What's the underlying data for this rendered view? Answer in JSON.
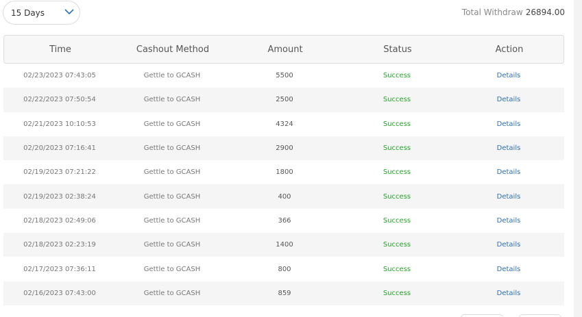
{
  "filter": {
    "selected": "15 Days",
    "icon": "chevron-down-icon",
    "accent": "#2a6ebb"
  },
  "summary": {
    "label": "Total Withdraw",
    "value": "26894.00"
  },
  "table": {
    "headers": {
      "time": "Time",
      "method": "Cashout Method",
      "amount": "Amount",
      "status": "Status",
      "action": "Action"
    },
    "rows": [
      {
        "time": "02/23/2023 07:43:05",
        "method": "Gettle to GCASH",
        "amount": "5500",
        "status": "Success",
        "action": "Details"
      },
      {
        "time": "02/22/2023 07:50:54",
        "method": "Gettle to GCASH",
        "amount": "2500",
        "status": "Success",
        "action": "Details"
      },
      {
        "time": "02/21/2023 10:10:53",
        "method": "Gettle to GCASH",
        "amount": "4324",
        "status": "Success",
        "action": "Details"
      },
      {
        "time": "02/20/2023 07:16:41",
        "method": "Gettle to GCASH",
        "amount": "2900",
        "status": "Success",
        "action": "Details"
      },
      {
        "time": "02/19/2023 07:21:22",
        "method": "Gettle to GCASH",
        "amount": "1800",
        "status": "Success",
        "action": "Details"
      },
      {
        "time": "02/19/2023 02:38:24",
        "method": "Gettle to GCASH",
        "amount": "400",
        "status": "Success",
        "action": "Details"
      },
      {
        "time": "02/18/2023 02:49:06",
        "method": "Gettle to GCASH",
        "amount": "366",
        "status": "Success",
        "action": "Details"
      },
      {
        "time": "02/18/2023 02:23:19",
        "method": "Gettle to GCASH",
        "amount": "1400",
        "status": "Success",
        "action": "Details"
      },
      {
        "time": "02/17/2023 07:36:11",
        "method": "Gettle to GCASH",
        "amount": "800",
        "status": "Success",
        "action": "Details"
      },
      {
        "time": "02/16/2023 07:43:00",
        "method": "Gettle to GCASH",
        "amount": "859",
        "status": "Success",
        "action": "Details"
      }
    ]
  },
  "colors": {
    "status_success": "#22a327",
    "link": "#2a6ebb",
    "row_alt": "#f5f5f5",
    "header_bg": "#f7f7f7"
  }
}
